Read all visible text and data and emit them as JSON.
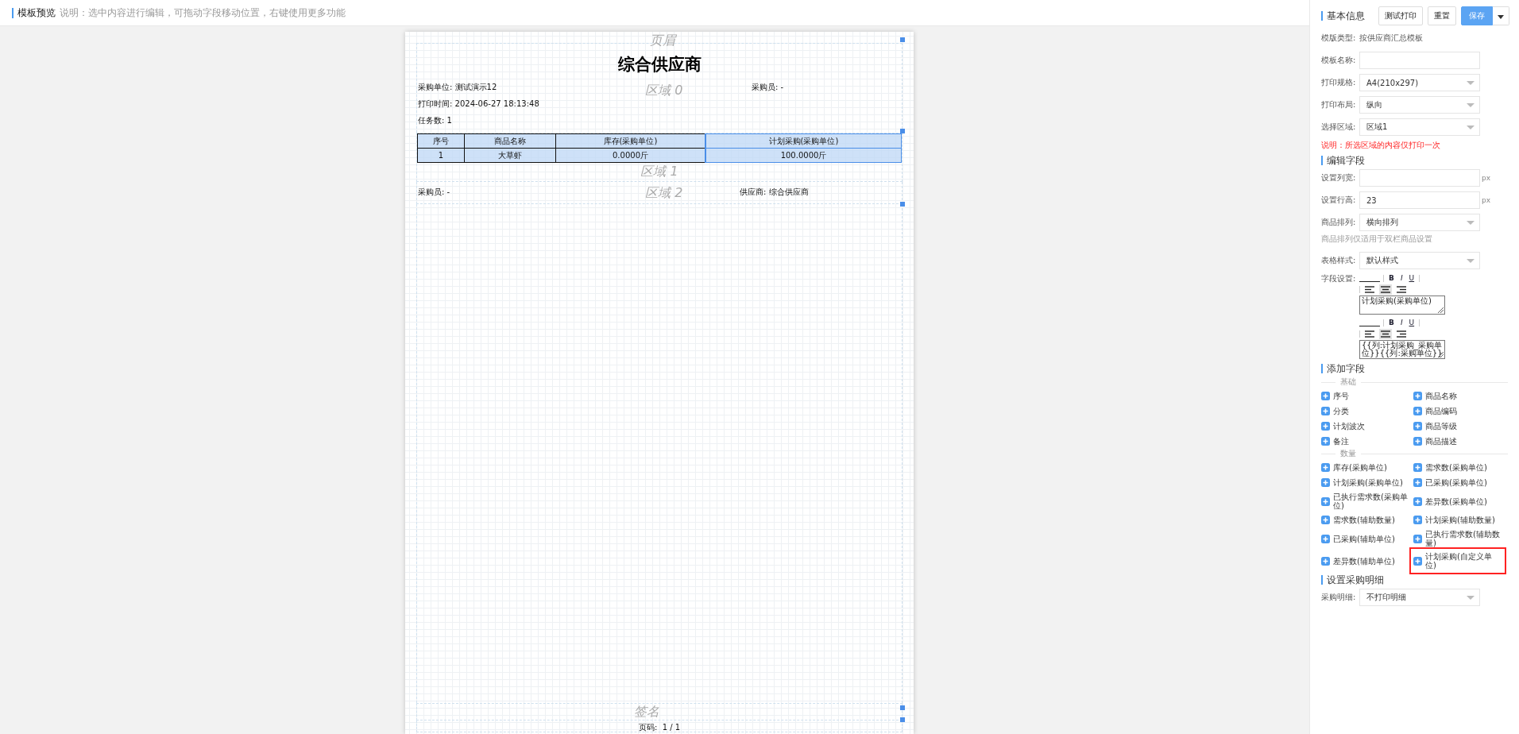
{
  "header": {
    "title": "模板预览",
    "note": "说明：选中内容进行编辑，可拖动字段移动位置，右键使用更多功能"
  },
  "page": {
    "region_labels": {
      "header": "页眉",
      "region0": "区域 0",
      "region1": "区域 1",
      "region2": "区域 2",
      "footer": "签名"
    },
    "title": "综合供应商",
    "info_rows": [
      {
        "left": "采购单位: 测试演示12",
        "right": "采购员: -"
      },
      {
        "left": "打印时间: 2024-06-27 18:13:48"
      },
      {
        "left": "任务数: 1"
      }
    ],
    "table": {
      "columns": [
        {
          "label": "序号",
          "selected": false
        },
        {
          "label": "商品名称",
          "selected": false
        },
        {
          "label": "库存(采购单位)",
          "selected": false
        },
        {
          "label": "计划采购(采购单位)",
          "selected": true
        }
      ],
      "rows": [
        [
          "1",
          "大草虾",
          "0.0000斤",
          "100.0000斤"
        ]
      ]
    },
    "footer_row": {
      "left": "采购员: -",
      "right": "供应商: 综合供应商"
    },
    "page_number": {
      "label": "页码:",
      "value": "1 / 1"
    }
  },
  "panel": {
    "basic_title": "基本信息",
    "buttons": [
      {
        "label": "测试打印",
        "kind": "default"
      },
      {
        "label": "重置",
        "kind": "default"
      },
      {
        "label": "保存",
        "kind": "primary"
      }
    ],
    "template_type": {
      "label": "模版类型:",
      "value": "按供应商汇总模板"
    },
    "basic_fields": [
      {
        "label": "模板名称:",
        "kind": "input"
      },
      {
        "label": "打印规格:",
        "kind": "select",
        "value": "A4(210x297)"
      },
      {
        "label": "打印布局:",
        "kind": "select",
        "value": "纵向"
      },
      {
        "label": "选择区域:",
        "kind": "select",
        "value": "区域1"
      }
    ],
    "area_note": "说明：所选区域的内容仅打印一次",
    "edit_title": "编辑字段",
    "edit_fields": [
      {
        "label": "设置列宽:",
        "kind": "input",
        "unit": "px"
      },
      {
        "label": "设置行高:",
        "kind": "input",
        "value": "23",
        "unit": "px"
      },
      {
        "label": "商品排列:",
        "kind": "select",
        "value": "横向排列"
      },
      {
        "label": "商品排列仅适用于双栏商品设置",
        "kind": "hint"
      },
      {
        "label": "表格样式:",
        "kind": "select",
        "value": "默认样式"
      }
    ],
    "field_settings": {
      "label": "字段设置:",
      "editors": [
        {
          "bold": "B",
          "italic": "I",
          "underline": "U",
          "alignments": [
            {
              "kind": "left",
              "selected": false
            },
            {
              "kind": "center",
              "selected": true
            },
            {
              "kind": "right",
              "selected": false
            }
          ],
          "text": "计划采购(采购单位)"
        },
        {
          "bold": "B",
          "italic": "I",
          "underline": "U",
          "alignments": [
            {
              "kind": "left",
              "selected": false
            },
            {
              "kind": "center",
              "selected": true
            },
            {
              "kind": "right",
              "selected": false
            }
          ],
          "text": "{{列:计划采购_采购单位}}{{列:采购单位}}"
        }
      ]
    },
    "add_title": "添加字段",
    "groups": [
      {
        "name": "基础",
        "items": [
          {
            "label": "序号",
            "highlighted": false
          },
          {
            "label": "商品名称",
            "highlighted": false
          },
          {
            "label": "分类",
            "highlighted": false
          },
          {
            "label": "商品编码",
            "highlighted": false
          },
          {
            "label": "计划波次",
            "highlighted": false
          },
          {
            "label": "商品等级",
            "highlighted": false
          },
          {
            "label": "备注",
            "highlighted": false
          },
          {
            "label": "商品描述",
            "highlighted": false
          }
        ]
      },
      {
        "name": "数量",
        "items": [
          {
            "label": "库存(采购单位)",
            "highlighted": false
          },
          {
            "label": "需求数(采购单位)",
            "highlighted": false
          },
          {
            "label": "计划采购(采购单位)",
            "highlighted": false
          },
          {
            "label": "已采购(采购单位)",
            "highlighted": false
          },
          {
            "label": "已执行需求数(采购单位)",
            "highlighted": false
          },
          {
            "label": "差异数(采购单位)",
            "highlighted": false
          },
          {
            "label": "需求数(辅助数量)",
            "highlighted": false
          },
          {
            "label": "计划采购(辅助数量)",
            "highlighted": false
          },
          {
            "label": "已采购(辅助单位)",
            "highlighted": false
          },
          {
            "label": "已执行需求数(辅助数量)",
            "highlighted": false
          },
          {
            "label": "差异数(辅助单位)",
            "highlighted": false
          },
          {
            "label": "计划采购(自定义单位)",
            "highlighted": true
          }
        ]
      }
    ],
    "detail_title": "设置采购明细",
    "detail_field": {
      "label": "采购明细:",
      "kind": "select",
      "value": "不打印明细"
    }
  }
}
